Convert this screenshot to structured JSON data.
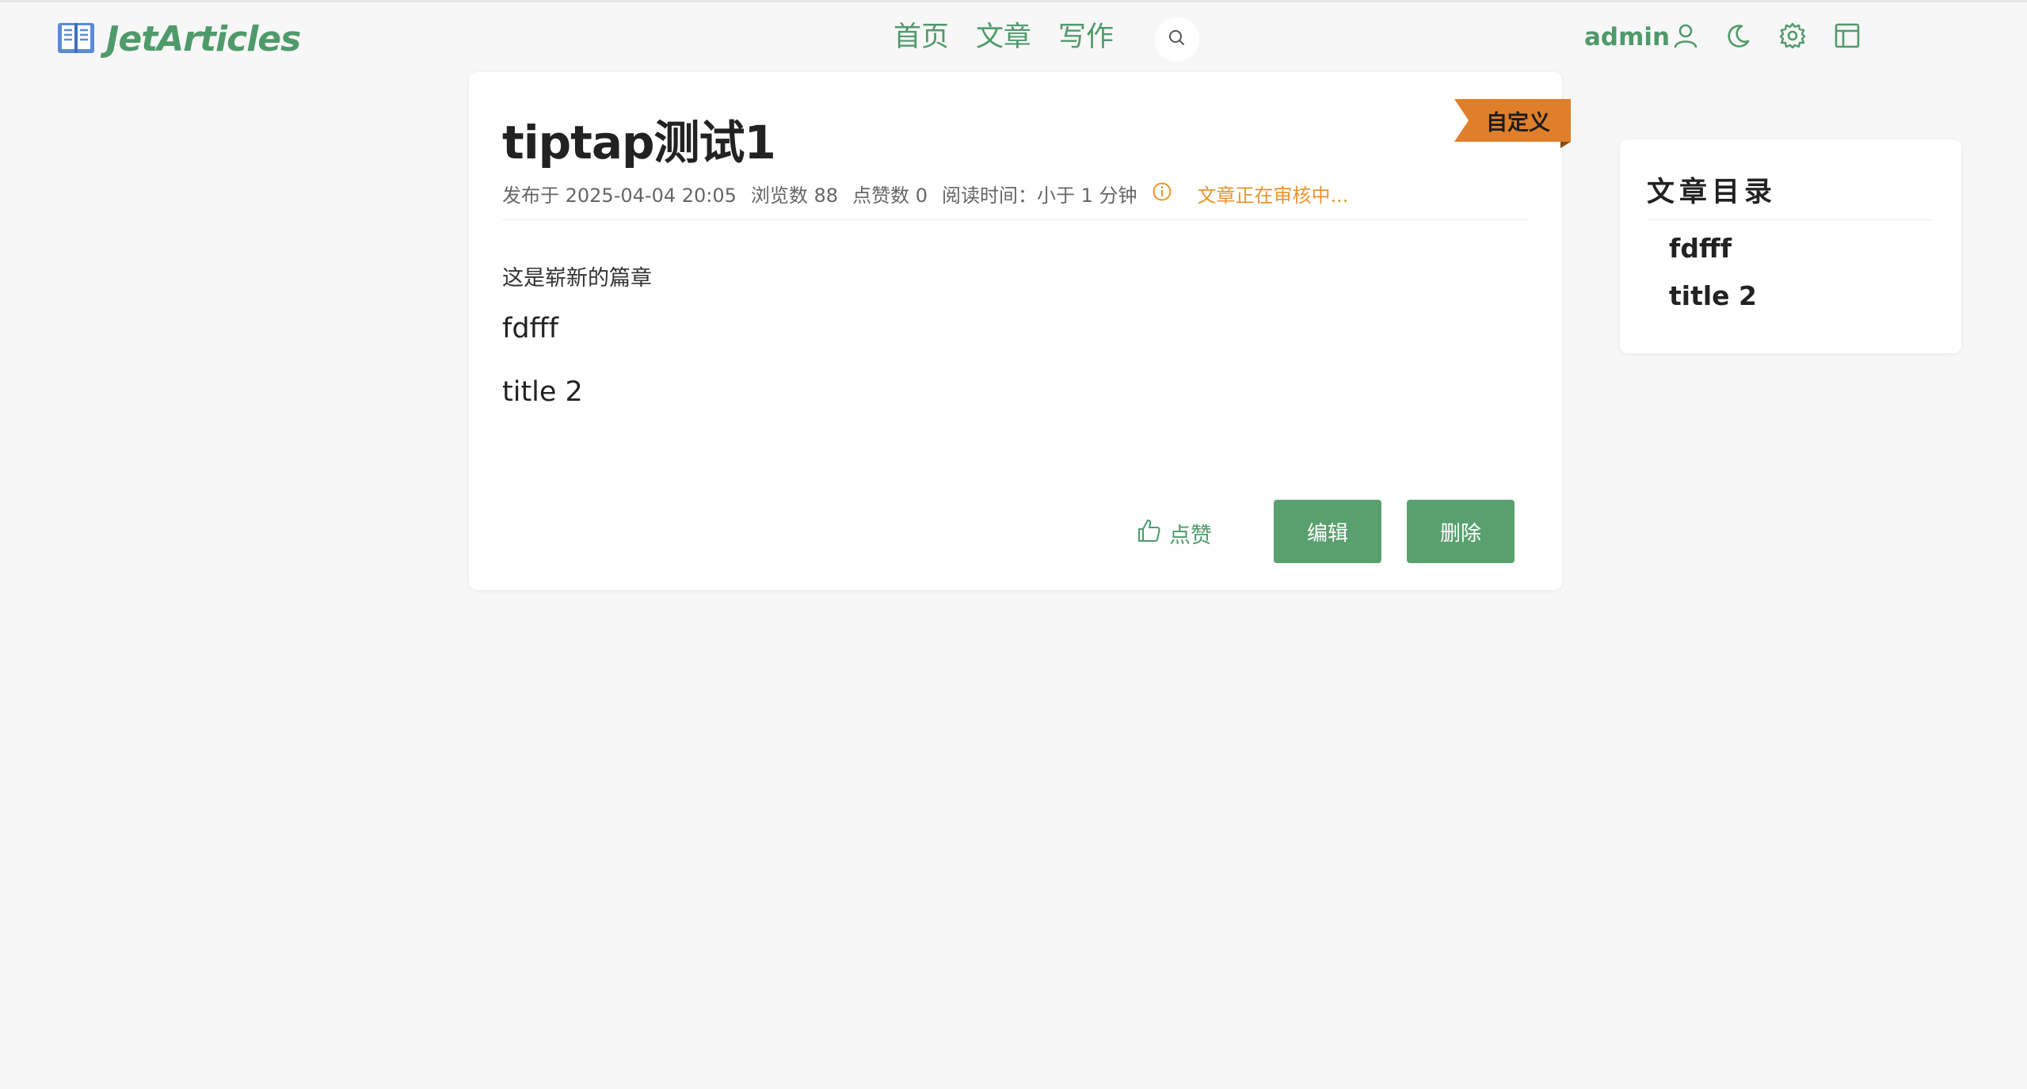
{
  "app": {
    "name": "JetArticles",
    "brand_color": "#4f9a6a"
  },
  "nav": {
    "items": [
      "首页",
      "文章",
      "写作"
    ]
  },
  "header": {
    "search_icon": "search-icon",
    "user_name": "admin",
    "icons": [
      "user-icon",
      "moon-icon",
      "gear-icon",
      "layout-icon"
    ]
  },
  "article": {
    "category_ribbon": "自定义",
    "title": "tiptap测试1",
    "meta": {
      "published": "发布于 2025-04-04 20:05",
      "views": "浏览数 88",
      "likes": "点赞数 0",
      "read_time": "阅读时间：小于 1 分钟",
      "review_status": "文章正在审核中..."
    },
    "body": {
      "paragraph": "这是崭新的篇章",
      "headings": [
        "fdfff",
        "title 2"
      ]
    },
    "actions": {
      "like_label": "点赞",
      "edit_label": "编辑",
      "delete_label": "删除"
    }
  },
  "toc": {
    "title": "文章目录",
    "items": [
      "fdfff",
      "title 2"
    ]
  },
  "colors": {
    "accent": "#4f9a6a",
    "button": "#5aa06f",
    "warning": "#e6952e",
    "ribbon": "#e07f2a"
  }
}
